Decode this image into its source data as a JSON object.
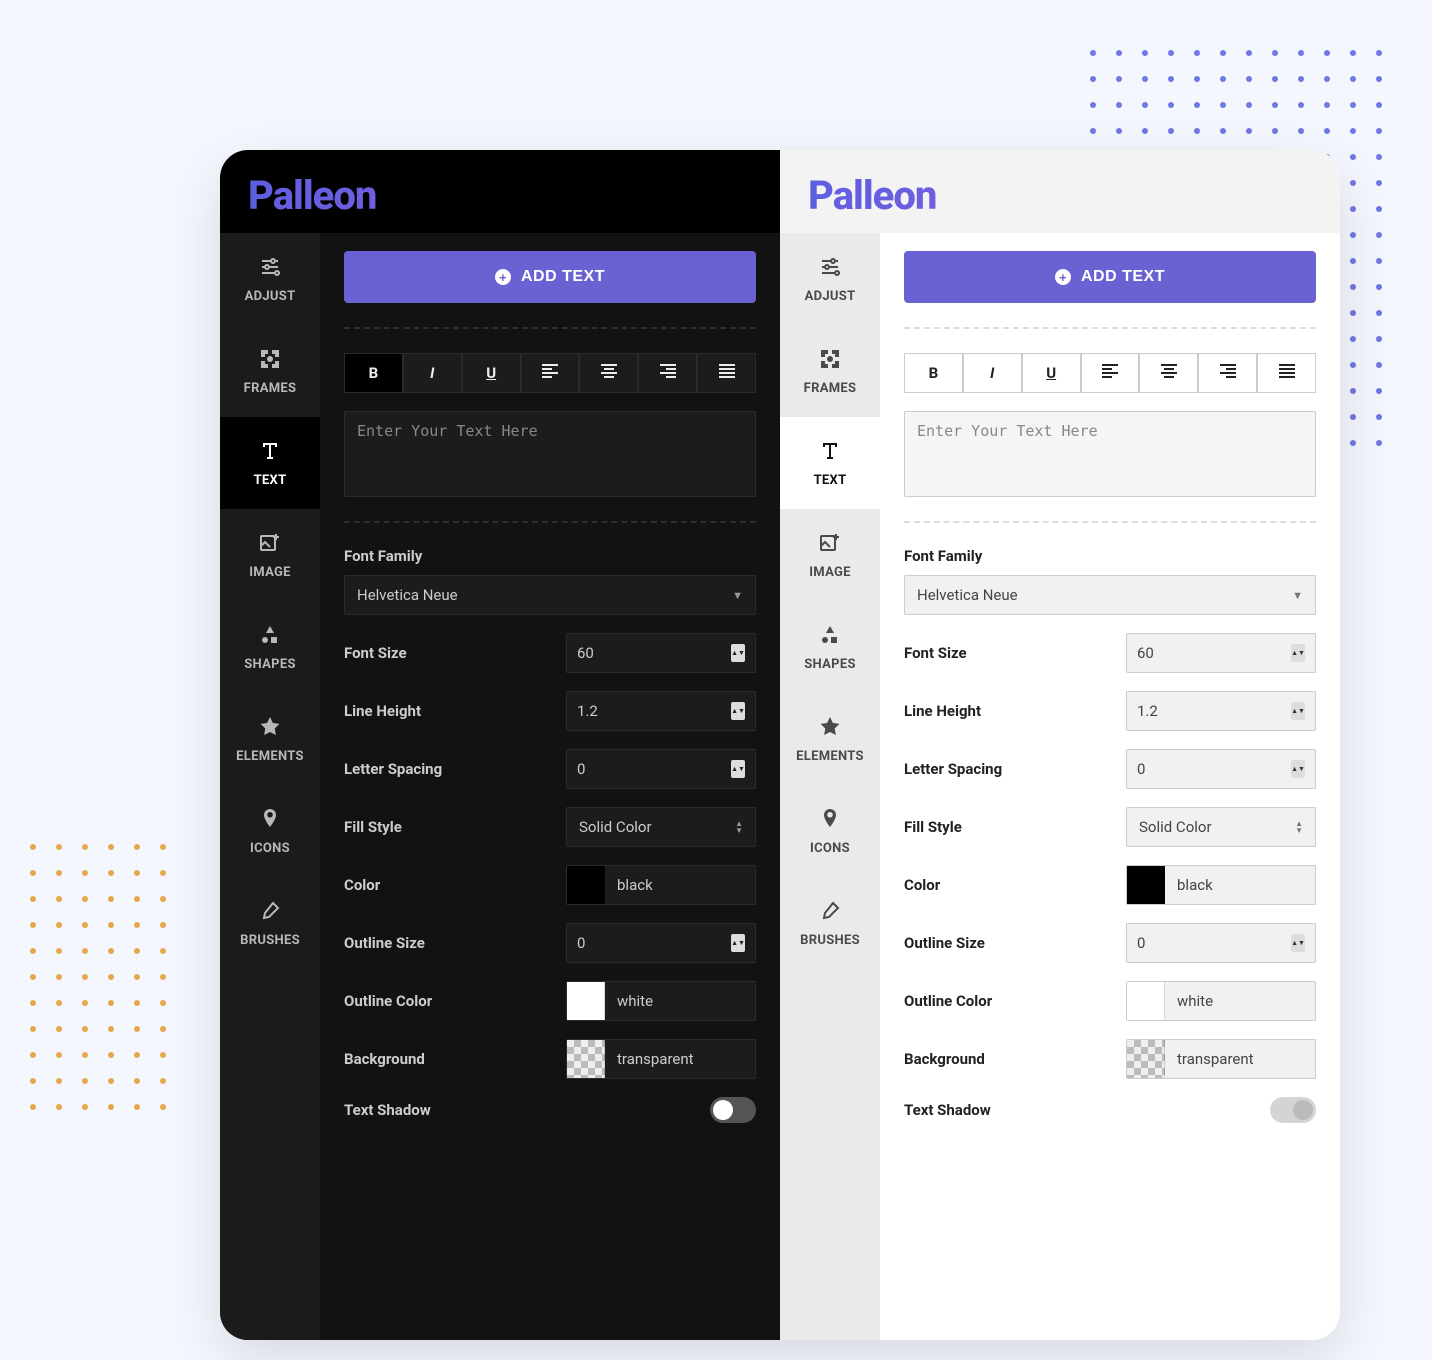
{
  "brand": "Palleon",
  "colors": {
    "primary": "#6a62d2"
  },
  "sidebar": {
    "items": [
      {
        "id": "adjust",
        "label": "ADJUST"
      },
      {
        "id": "frames",
        "label": "FRAMES"
      },
      {
        "id": "text",
        "label": "TEXT",
        "active": true
      },
      {
        "id": "image",
        "label": "IMAGE"
      },
      {
        "id": "shapes",
        "label": "SHAPES"
      },
      {
        "id": "elements",
        "label": "ELEMENTS"
      },
      {
        "id": "icons",
        "label": "ICONS"
      },
      {
        "id": "brushes",
        "label": "BRUSHES"
      }
    ]
  },
  "text_panel": {
    "add_button": "ADD TEXT",
    "textarea_placeholder": "Enter Your Text Here",
    "format_buttons": [
      "bold",
      "italic",
      "underline",
      "align-left",
      "align-center",
      "align-right",
      "align-justify"
    ],
    "font_family_label": "Font Family",
    "font_family_value": "Helvetica Neue",
    "rows": {
      "font_size": {
        "label": "Font Size",
        "value": "60"
      },
      "line_height": {
        "label": "Line Height",
        "value": "1.2"
      },
      "letter_spacing": {
        "label": "Letter Spacing",
        "value": "0"
      },
      "fill_style": {
        "label": "Fill Style",
        "value": "Solid Color"
      },
      "color": {
        "label": "Color",
        "value": "black",
        "swatch": "black"
      },
      "outline_size": {
        "label": "Outline Size",
        "value": "0"
      },
      "outline_color": {
        "label": "Outline Color",
        "value": "white",
        "swatch": "white"
      },
      "background": {
        "label": "Background",
        "value": "transparent",
        "swatch": "transparent"
      },
      "text_shadow": {
        "label": "Text Shadow",
        "value": false
      }
    }
  }
}
